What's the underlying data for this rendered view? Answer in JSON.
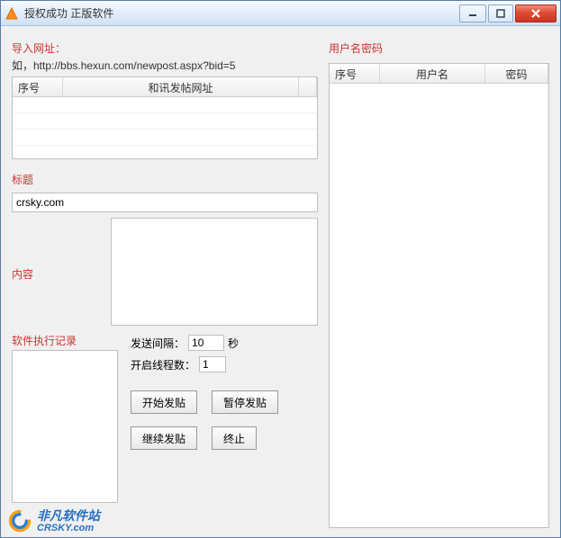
{
  "window": {
    "title": "授权成功 正版软件"
  },
  "import_url": {
    "label": "导入网址：",
    "example": "如，http://bbs.hexun.com/newpost.aspx?bid=5",
    "cols": {
      "seq": "序号",
      "addr": "和讯发帖网址"
    }
  },
  "title_sec": {
    "label": "标题",
    "value": "crsky.com"
  },
  "content_sec": {
    "label": "内容",
    "value": ""
  },
  "log_sec": {
    "label": "软件执行记录",
    "value": ""
  },
  "params": {
    "interval_label": "发送间隔：",
    "interval_value": "10",
    "interval_unit": "秒",
    "threads_label": "开启线程数：",
    "threads_value": "1"
  },
  "buttons": {
    "start": "开始发贴",
    "pause": "暂停发贴",
    "resume": "继续发贴",
    "stop": "终止"
  },
  "credentials": {
    "label": "用户名密码",
    "cols": {
      "seq": "序号",
      "user": "用户名",
      "pwd": "密码"
    }
  },
  "watermark": {
    "cn": "非凡软件站",
    "en": "CRSKY.com"
  }
}
